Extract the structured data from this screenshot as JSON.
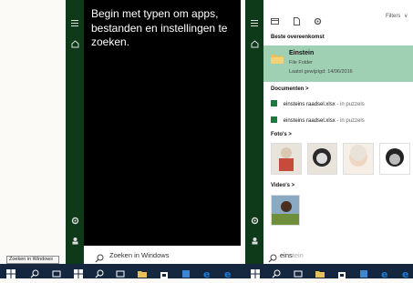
{
  "left_panel": {
    "prompt": "Begin met typen om apps, bestanden en instellingen te zoeken.",
    "search_placeholder": "Zoeken in Windows"
  },
  "tooltip": "Zoeken in Windows",
  "right_panel": {
    "filters_label": "Filters",
    "best_match_header": "Beste overeenkomst",
    "best_match": {
      "name": "Einstein",
      "type": "File Folder",
      "modified": "Laatst gewijzigd: 14/06/2016"
    },
    "documents_header": "Documenten",
    "documents": [
      {
        "name": "einsteins raadsel.xlsx",
        "location": "- in puzzels"
      },
      {
        "name": "einsteins raadsel.xlsx",
        "location": "- in puzzels"
      }
    ],
    "photos_header": "Foto's",
    "videos_header": "Video's",
    "search_typed": "eins",
    "search_hint": "tein"
  },
  "colors": {
    "taskbar": "#14273f",
    "rail": "#0e3a1a",
    "accent_icon": "#1e7bd6",
    "best_match_bg": "#9fd0b3"
  },
  "icons": [
    "windows-icon",
    "search-icon",
    "task-view-icon",
    "store-icon",
    "explorer-icon",
    "edge-icon",
    "settings-icon",
    "home-icon",
    "user-icon",
    "document-icon",
    "apps-icon"
  ]
}
